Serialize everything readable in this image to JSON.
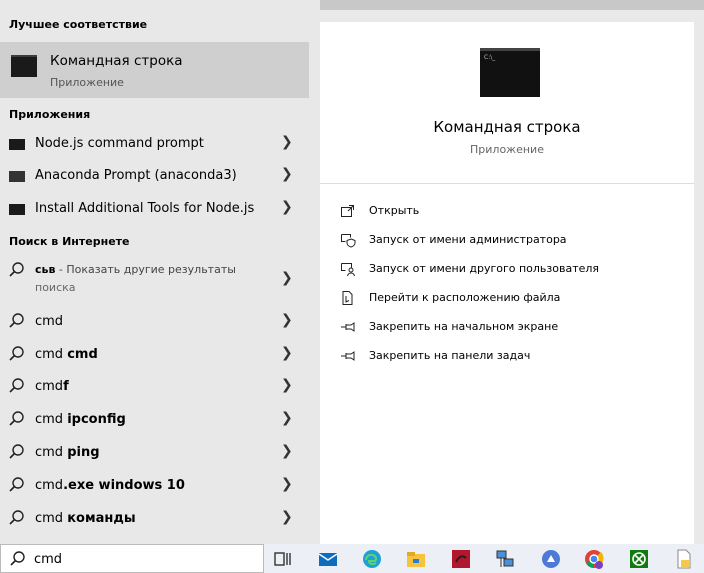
{
  "best_match": {
    "header": "Лучшее соответствие",
    "title": "Командная строка",
    "subtitle": "Приложение"
  },
  "apps": {
    "header": "Приложения",
    "items": [
      {
        "label": "Node.js command prompt"
      },
      {
        "label": "Anaconda Prompt (anaconda3)"
      },
      {
        "label": "Install Additional Tools for Node.js"
      }
    ]
  },
  "web": {
    "header": "Поиск в Интернете",
    "first": {
      "bold": "сьв",
      "rest": " - Показать другие результаты",
      "sub": "поиска"
    },
    "items": [
      {
        "prefix": "cmd",
        "bold": ""
      },
      {
        "prefix": "cmd ",
        "bold": "cmd"
      },
      {
        "prefix": "cmd",
        "bold": "f"
      },
      {
        "prefix": "cmd ",
        "bold": "ipconfig"
      },
      {
        "prefix": "cmd ",
        "bold": "ping"
      },
      {
        "prefix": "cmd",
        "bold": ".exe windows 10"
      },
      {
        "prefix": "cmd ",
        "bold": "команды"
      }
    ]
  },
  "preview": {
    "title": "Командная строка",
    "subtitle": "Приложение",
    "actions": [
      {
        "label": "Открыть",
        "icon": "open-icon"
      },
      {
        "label": "Запуск от имени администратора",
        "icon": "admin-shield-icon"
      },
      {
        "label": "Запуск от имени другого пользователя",
        "icon": "other-user-icon"
      },
      {
        "label": "Перейти к расположению файла",
        "icon": "file-location-icon"
      },
      {
        "label": "Закрепить на начальном экране",
        "icon": "pin-icon"
      },
      {
        "label": "Закрепить на панели задач",
        "icon": "pin-icon"
      }
    ]
  },
  "taskbar": {
    "search_value": "cmd",
    "icons": [
      "task-view-icon",
      "mail-icon",
      "edge-icon",
      "file-explorer-icon",
      "app-icon",
      "network-icon",
      "app-icon",
      "chrome-icon",
      "xbox-icon",
      "file-icon"
    ]
  }
}
